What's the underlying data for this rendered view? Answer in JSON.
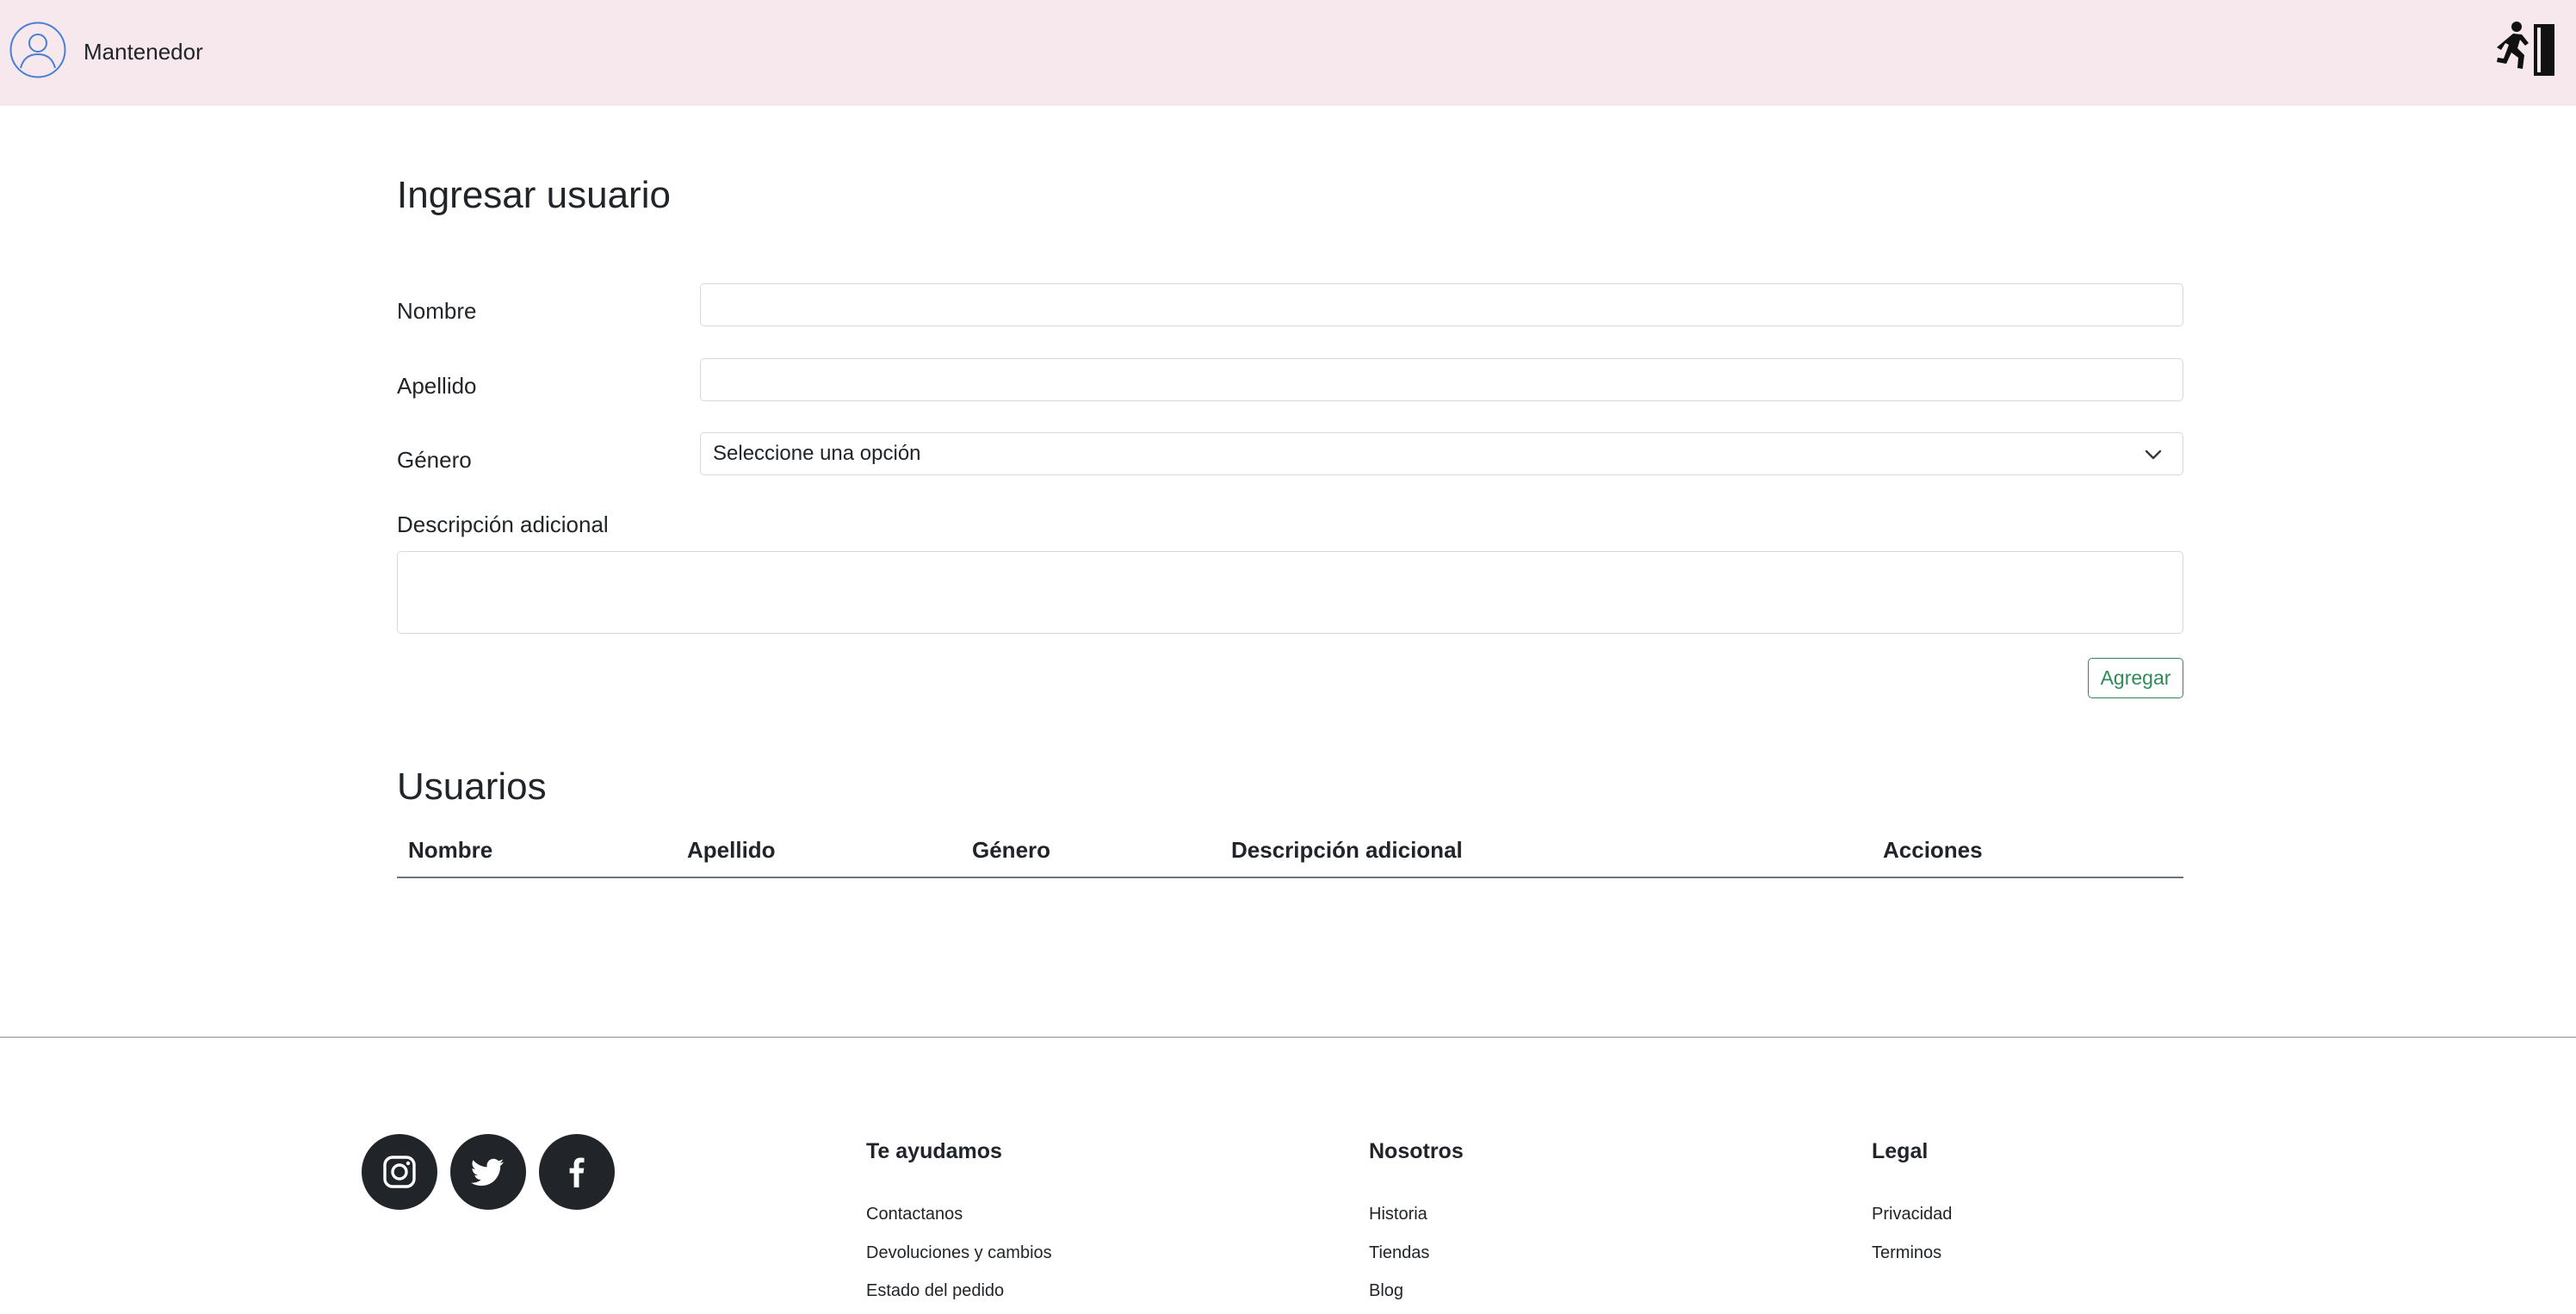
{
  "header": {
    "brand": "Mantenedor",
    "avatar_icon": "user-circle-icon",
    "logout_icon": "exit-running-icon",
    "background": "#f6e8ec"
  },
  "form": {
    "title": "Ingresar usuario",
    "nombre_label": "Nombre",
    "nombre_value": "",
    "apellido_label": "Apellido",
    "apellido_value": "",
    "genero_label": "Género",
    "genero_selected": "Seleccione una opción",
    "descripcion_label": "Descripción adicional",
    "descripcion_value": "",
    "submit_label": "Agregar",
    "submit_color": "#2e8b57"
  },
  "users": {
    "title": "Usuarios",
    "columns": [
      "Nombre",
      "Apellido",
      "Género",
      "Descripción adicional",
      "Acciones"
    ],
    "rows": []
  },
  "footer": {
    "social": [
      "instagram-icon",
      "twitter-icon",
      "facebook-icon"
    ],
    "columns": [
      {
        "title": "Te ayudamos",
        "links": [
          "Contactanos",
          "Devoluciones y cambios",
          "Estado del pedido"
        ]
      },
      {
        "title": "Nosotros",
        "links": [
          "Historia",
          "Tiendas",
          "Blog"
        ]
      },
      {
        "title": "Legal",
        "links": [
          "Privacidad",
          "Terminos"
        ]
      }
    ]
  }
}
